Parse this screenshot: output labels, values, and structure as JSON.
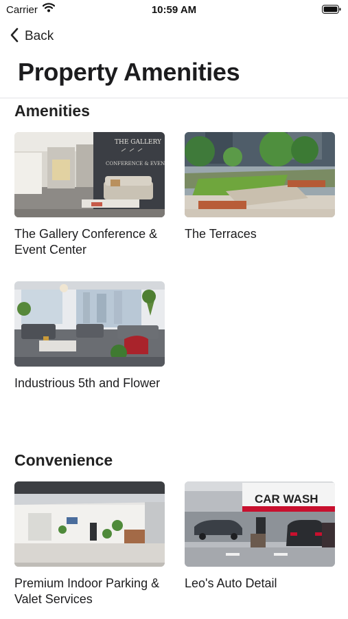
{
  "status_bar": {
    "carrier": "Carrier",
    "time": "10:59 AM",
    "icons": [
      "wifi-icon",
      "battery-icon"
    ]
  },
  "nav": {
    "back_label": "Back",
    "back_icon": "chevron-left-icon"
  },
  "page": {
    "title": "Property Amenities"
  },
  "sections": [
    {
      "title": "Amenities",
      "cards": [
        {
          "label": "The Gallery Conference & Event Center",
          "image_sign": [
            "THE GALLERY",
            "CONFERENCE & EVENT C"
          ]
        },
        {
          "label": "The Terraces"
        },
        {
          "label": "Industrious 5th and Flower"
        }
      ]
    },
    {
      "title": "Convenience",
      "cards": [
        {
          "label": "Premium Indoor Parking & Valet Services"
        },
        {
          "label": "Leo's Auto Detail",
          "image_sign": "CAR WASH"
        }
      ]
    }
  ],
  "colors": {
    "text": "#1c1c1e",
    "divider": "#e3e3e6",
    "background": "#ffffff",
    "carwash_red": "#c8102e"
  }
}
